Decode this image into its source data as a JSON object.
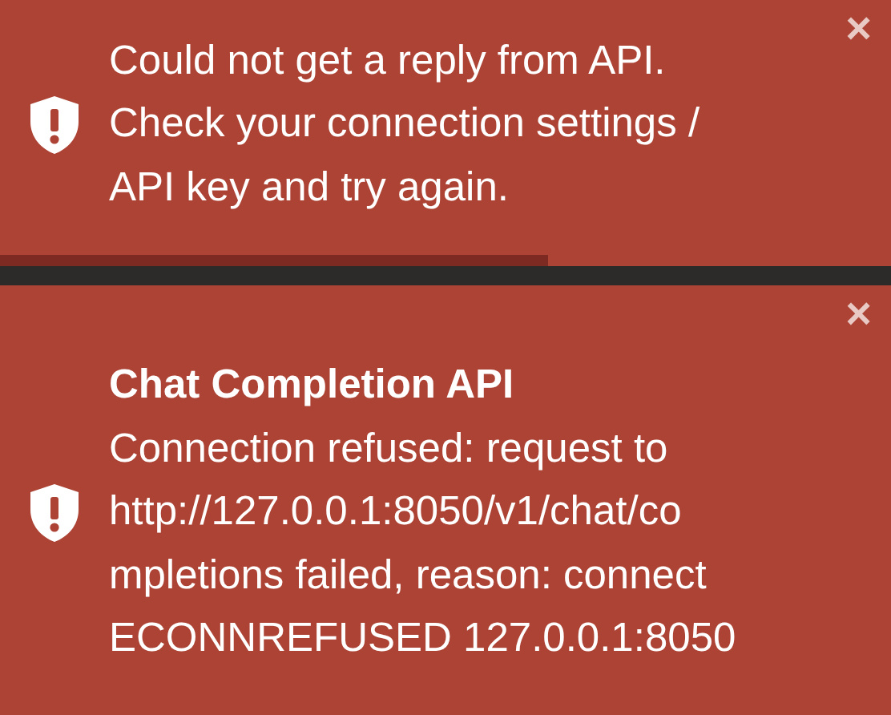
{
  "toasts": [
    {
      "lines": [
        "Could not get a reply from API.",
        "Check your connection settings /",
        "API key and try again."
      ],
      "close": "×",
      "progress": {
        "level": 0.615
      }
    },
    {
      "title": "Chat Completion API",
      "lines": [
        "Connection refused: request to",
        "http://127.0.0.1:8050/v1/chat/co",
        "mpletions failed, reason: connect",
        "ECONNREFUSED 127.0.0.1:8050"
      ],
      "close": "×"
    }
  ]
}
